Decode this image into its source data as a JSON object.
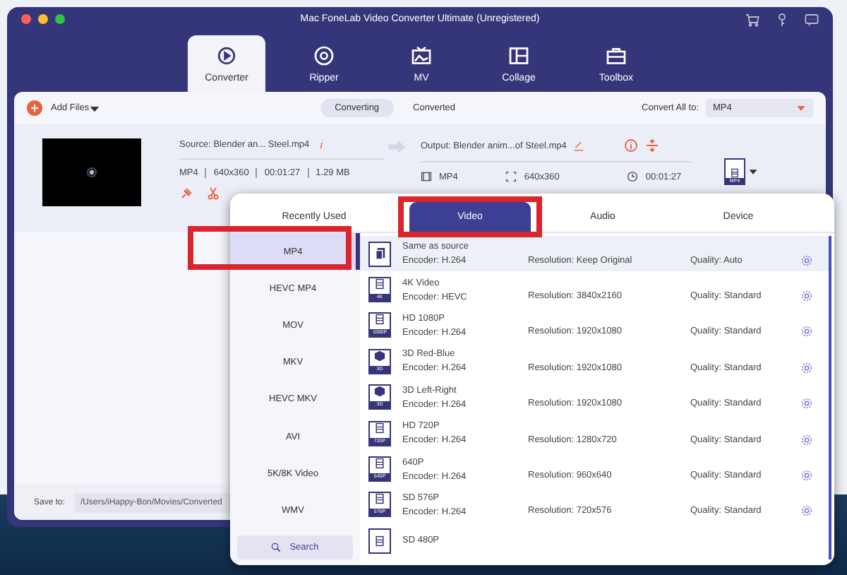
{
  "window": {
    "title": "Mac FoneLab Video Converter Ultimate (Unregistered)"
  },
  "nav_tabs": [
    {
      "label": "Converter",
      "selected": true
    },
    {
      "label": "Ripper",
      "selected": false
    },
    {
      "label": "MV",
      "selected": false
    },
    {
      "label": "Collage",
      "selected": false
    },
    {
      "label": "Toolbox",
      "selected": false
    }
  ],
  "toolbar": {
    "add_files": "Add Files",
    "view_tabs": [
      {
        "label": "Converting",
        "selected": true
      },
      {
        "label": "Converted",
        "selected": false
      }
    ],
    "convert_all_label": "Convert All to:",
    "convert_all_value": "MP4"
  },
  "file": {
    "source": "Source: Blender an... Steel.mp4",
    "format": "MP4",
    "resolution": "640x360",
    "duration": "00:01:27",
    "size": "1.29 MB",
    "output": "Output: Blender anim...of Steel.mp4",
    "output_format": "MP4",
    "output_resolution": "640x360",
    "output_duration": "00:01:27",
    "format_badge": "MP4"
  },
  "save_to": {
    "label": "Save to:",
    "path": "/Users/iHappy-Bon/Movies/Converted"
  },
  "format_popup": {
    "tabs": [
      {
        "label": "Recently Used",
        "selected": false
      },
      {
        "label": "Video",
        "selected": true,
        "highlighted": true
      },
      {
        "label": "Audio",
        "selected": false
      },
      {
        "label": "Device",
        "selected": false
      }
    ],
    "formats": [
      {
        "label": "MP4",
        "selected": true,
        "highlighted": true
      },
      {
        "label": "HEVC MP4",
        "selected": false
      },
      {
        "label": "MOV",
        "selected": false
      },
      {
        "label": "MKV",
        "selected": false
      },
      {
        "label": "HEVC MKV",
        "selected": false
      },
      {
        "label": "AVI",
        "selected": false
      },
      {
        "label": "5K/8K Video",
        "selected": false
      },
      {
        "label": "WMV",
        "selected": false
      }
    ],
    "search": "Search",
    "presets": [
      {
        "kind": "copy",
        "name": "Same as source",
        "encoder": "Encoder: H.264",
        "resolution": "Resolution: Keep Original",
        "quality": "Quality: Auto",
        "selected": true
      },
      {
        "kind": "film",
        "badge": "4K",
        "name": "4K Video",
        "encoder": "Encoder: HEVC",
        "resolution": "Resolution: 3840x2160",
        "quality": "Quality: Standard",
        "selected": false
      },
      {
        "kind": "film",
        "badge": "1080P",
        "name": "HD 1080P",
        "encoder": "Encoder: H.264",
        "resolution": "Resolution: 1920x1080",
        "quality": "Quality: Standard",
        "selected": false
      },
      {
        "kind": "cube",
        "badge": "3D",
        "name": "3D Red-Blue",
        "encoder": "Encoder: H.264",
        "resolution": "Resolution: 1920x1080",
        "quality": "Quality: Standard",
        "selected": false
      },
      {
        "kind": "cube",
        "badge": "3D",
        "name": "3D Left-Right",
        "encoder": "Encoder: H.264",
        "resolution": "Resolution: 1920x1080",
        "quality": "Quality: Standard",
        "selected": false
      },
      {
        "kind": "film",
        "badge": "720P",
        "name": "HD 720P",
        "encoder": "Encoder: H.264",
        "resolution": "Resolution: 1280x720",
        "quality": "Quality: Standard",
        "selected": false
      },
      {
        "kind": "film",
        "badge": "640P",
        "name": "640P",
        "encoder": "Encoder: H.264",
        "resolution": "Resolution: 960x640",
        "quality": "Quality: Standard",
        "selected": false
      },
      {
        "kind": "film",
        "badge": "576P",
        "name": "SD 576P",
        "encoder": "Encoder: H.264",
        "resolution": "Resolution: 720x576",
        "quality": "Quality: Standard",
        "selected": false
      },
      {
        "kind": "film",
        "name": "SD 480P",
        "selected": false
      }
    ]
  }
}
